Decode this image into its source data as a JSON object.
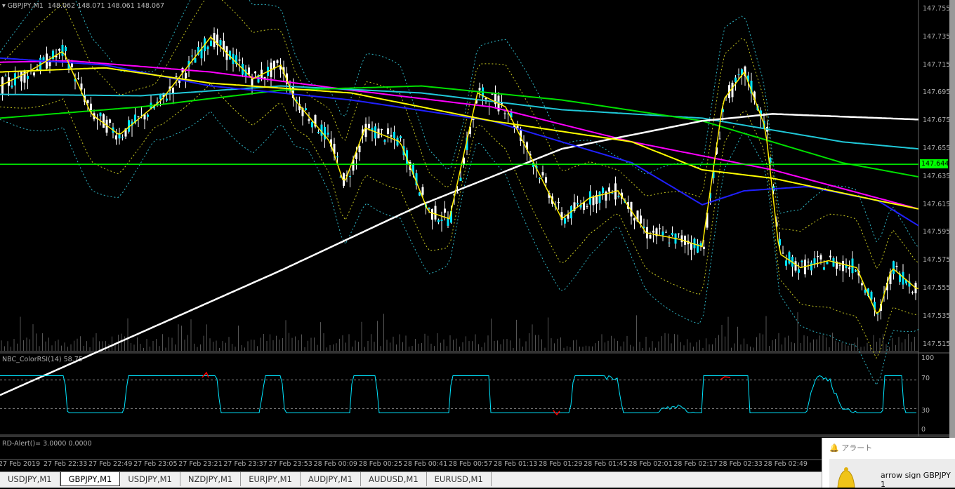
{
  "chart": {
    "title": "GBPJPY,M1",
    "ohlc": "148.062 148.071 148.061 148.067",
    "current_price": "147.644",
    "price_labels": [
      "147.755",
      "147.735",
      "147.715",
      "147.695",
      "147.675",
      "147.655",
      "147.635",
      "147.615",
      "147.595",
      "147.575",
      "147.555",
      "147.535",
      "147.515"
    ],
    "colors": {
      "bull": "#00e5ff",
      "bear": "#ffffff",
      "price_line": "#00ff00"
    }
  },
  "rsi": {
    "title": "NBC_ColorRSI(14) 58.75",
    "levels": [
      "100",
      "70",
      "30",
      "0"
    ]
  },
  "rd_alert": {
    "title": "RD-Alert()=  3.0000 0.0000"
  },
  "time_axis": [
    "27 Feb 2019",
    "27 Feb 22:33",
    "27 Feb 22:49",
    "27 Feb 23:05",
    "27 Feb 23:21",
    "27 Feb 23:37",
    "27 Feb 23:53",
    "28 Feb 00:09",
    "28 Feb 00:25",
    "28 Feb 00:41",
    "28 Feb 00:57",
    "28 Feb 01:13",
    "28 Feb 01:29",
    "28 Feb 01:45",
    "28 Feb 02:01",
    "28 Feb 02:17",
    "28 Feb 02:33",
    "28 Feb 02:49"
  ],
  "tabs": [
    "USDJPY,M1",
    "GBPJPY,M1",
    "USDJPY,M1",
    "NZDJPY,M1",
    "EURJPY,M1",
    "AUDJPY,M1",
    "AUDUSD,M1",
    "EURUSD,M1"
  ],
  "active_tab": 1,
  "alert": {
    "title": "アラート",
    "message": "arrow sign GBPJPY 1"
  }
}
